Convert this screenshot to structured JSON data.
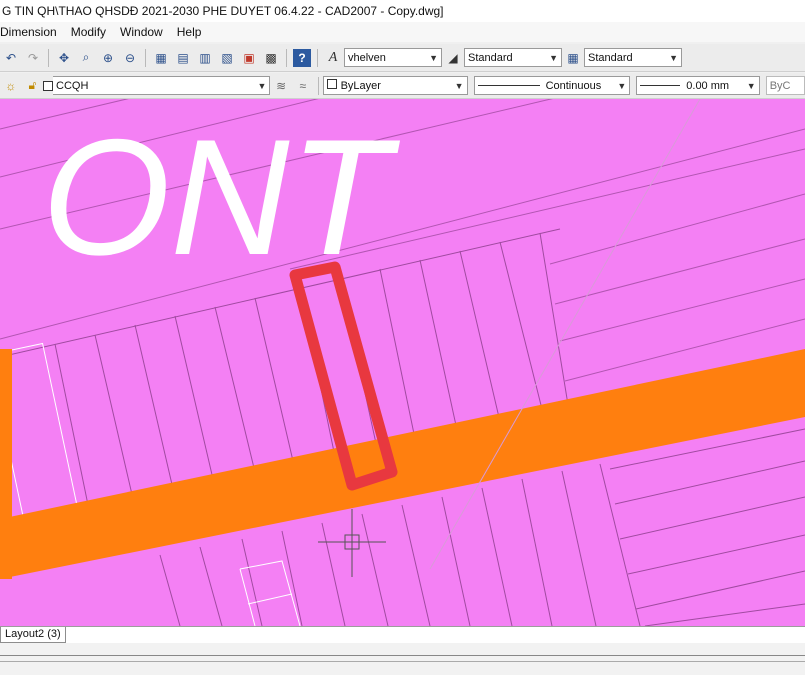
{
  "window": {
    "title": "G TIN QH\\THAO QHSDĐ 2021-2030 PHE DUYET 06.4.22 - CAD2007 - Copy.dwg]"
  },
  "menu": {
    "items": [
      "Dimension",
      "Modify",
      "Window",
      "Help"
    ]
  },
  "toolbar1": {
    "text_style": "vhelven",
    "dim_style": "Standard",
    "table_style": "Standard"
  },
  "toolbar2": {
    "layer": "CCQH",
    "color": "ByLayer",
    "linetype": "Continuous",
    "lineweight": "0.00 mm",
    "plotstyle": "ByC"
  },
  "drawing": {
    "zone_label": "ONT",
    "colors": {
      "background": "#f480f4",
      "road": "#ff7f0f",
      "highlight": "#e8383f",
      "parcel_lines": "#a04aa0"
    }
  },
  "layout_tabs": [
    "Layout2 (3)"
  ]
}
